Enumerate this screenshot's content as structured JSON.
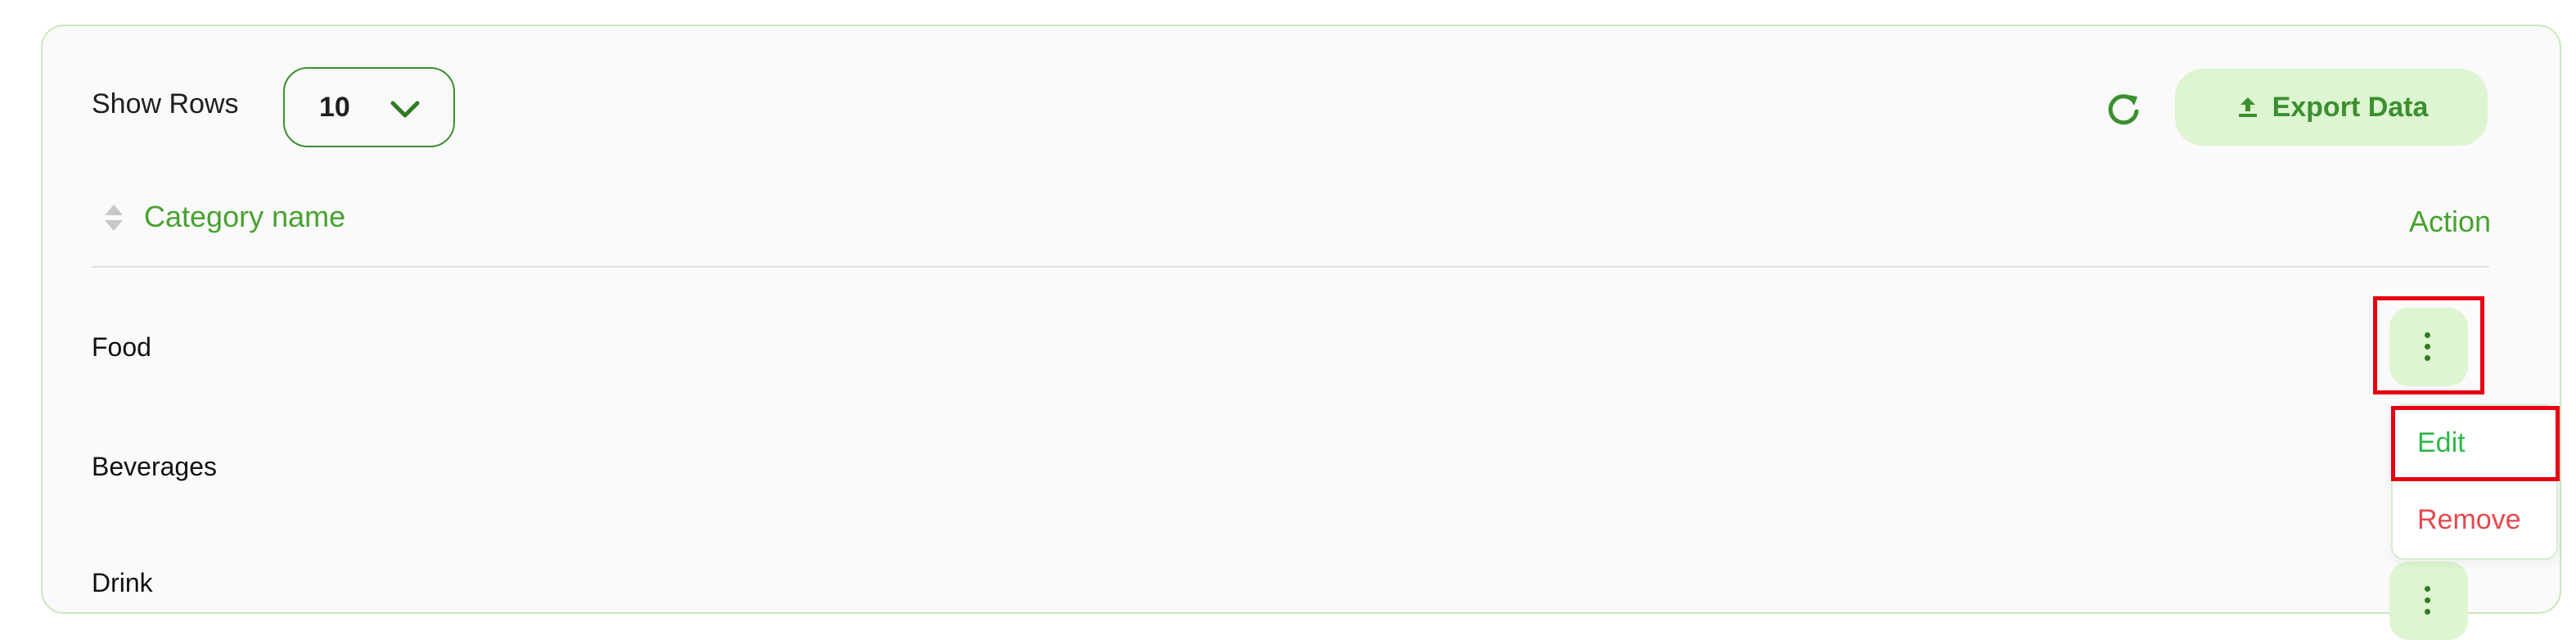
{
  "toolbar": {
    "show_rows_label": "Show Rows",
    "rows_per_page": "10",
    "export_label": "Export Data"
  },
  "table": {
    "columns": [
      "Category name",
      "Action"
    ],
    "rows": [
      {
        "name": "Food"
      },
      {
        "name": "Beverages"
      },
      {
        "name": "Drink"
      }
    ]
  },
  "row_menu": {
    "edit_label": "Edit",
    "remove_label": "Remove"
  },
  "icons": {
    "select": "chevron-down-icon",
    "refresh": "refresh-icon",
    "export": "upload-icon",
    "sort": "sort-icon",
    "row_actions": "kebab-menu-icon"
  },
  "colors": {
    "primary_green": "#3b8f2f",
    "header_green": "#46a22e",
    "button_bg": "#ddf5d1",
    "edit": "#2eb84a",
    "remove": "#e5484d",
    "highlight": "#e60012"
  }
}
